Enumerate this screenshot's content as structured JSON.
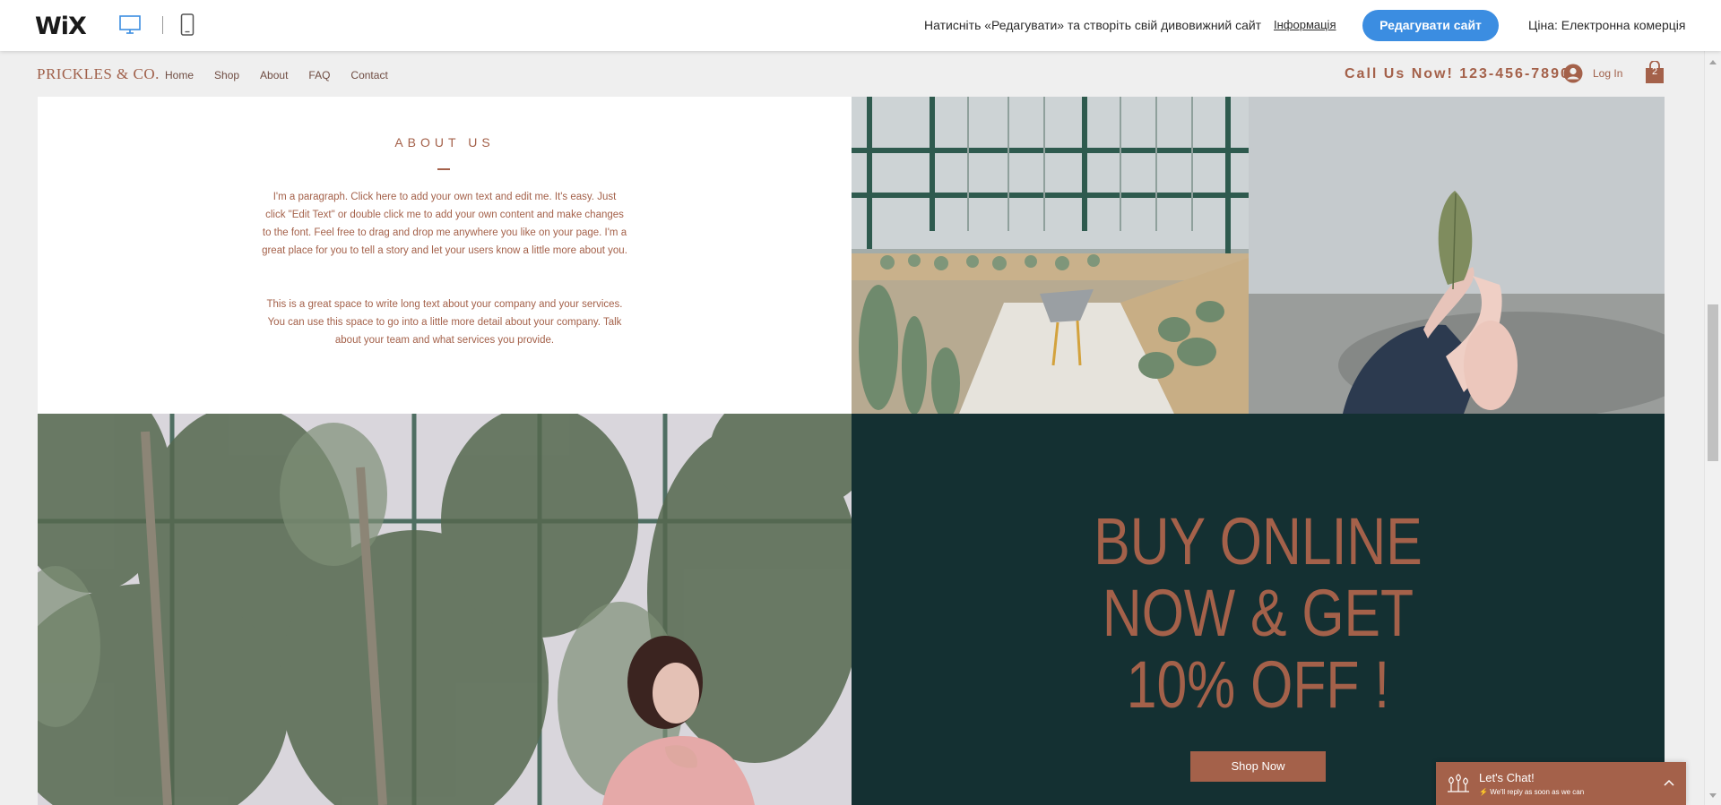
{
  "wixbar": {
    "logo": "WiX",
    "message": "Натисніть «Редагувати» та створіть свій дивовижний сайт",
    "info_link": "Інформація",
    "edit_button": "Редагувати сайт",
    "price": "Ціна: Електронна комерція"
  },
  "header": {
    "brand": "PRICKLES & CO.",
    "nav": [
      "Home",
      "Shop",
      "About",
      "FAQ",
      "Contact"
    ],
    "call": "Call Us Now! 123-456-7890",
    "login": "Log In",
    "cart_count": "2"
  },
  "about": {
    "title": "ABOUT US",
    "paragraph1": "I'm a paragraph. Click here to add your own text and edit me. It's easy. Just click \"Edit Text\" or double click me to add your own content and make changes to the font. Feel free to drag and drop me anywhere you like on your page. I'm a great place for you to tell a story and let your users know a little more about you.",
    "paragraph2": "This is a great space to write long text about your company and your services. You can use this space to go into a little more detail about your company. Talk about your team and what services you provide."
  },
  "promo": {
    "line1": "BUY ONLINE",
    "line2": "NOW & GET",
    "line3": "10% OFF !",
    "button": "Shop Now"
  },
  "chat": {
    "title": "Let's Chat!",
    "subtitle": "We'll reply as soon as we can"
  },
  "colors": {
    "accent": "#a4614a",
    "promo_bg": "#143032",
    "wix_blue": "#3b8de1"
  }
}
